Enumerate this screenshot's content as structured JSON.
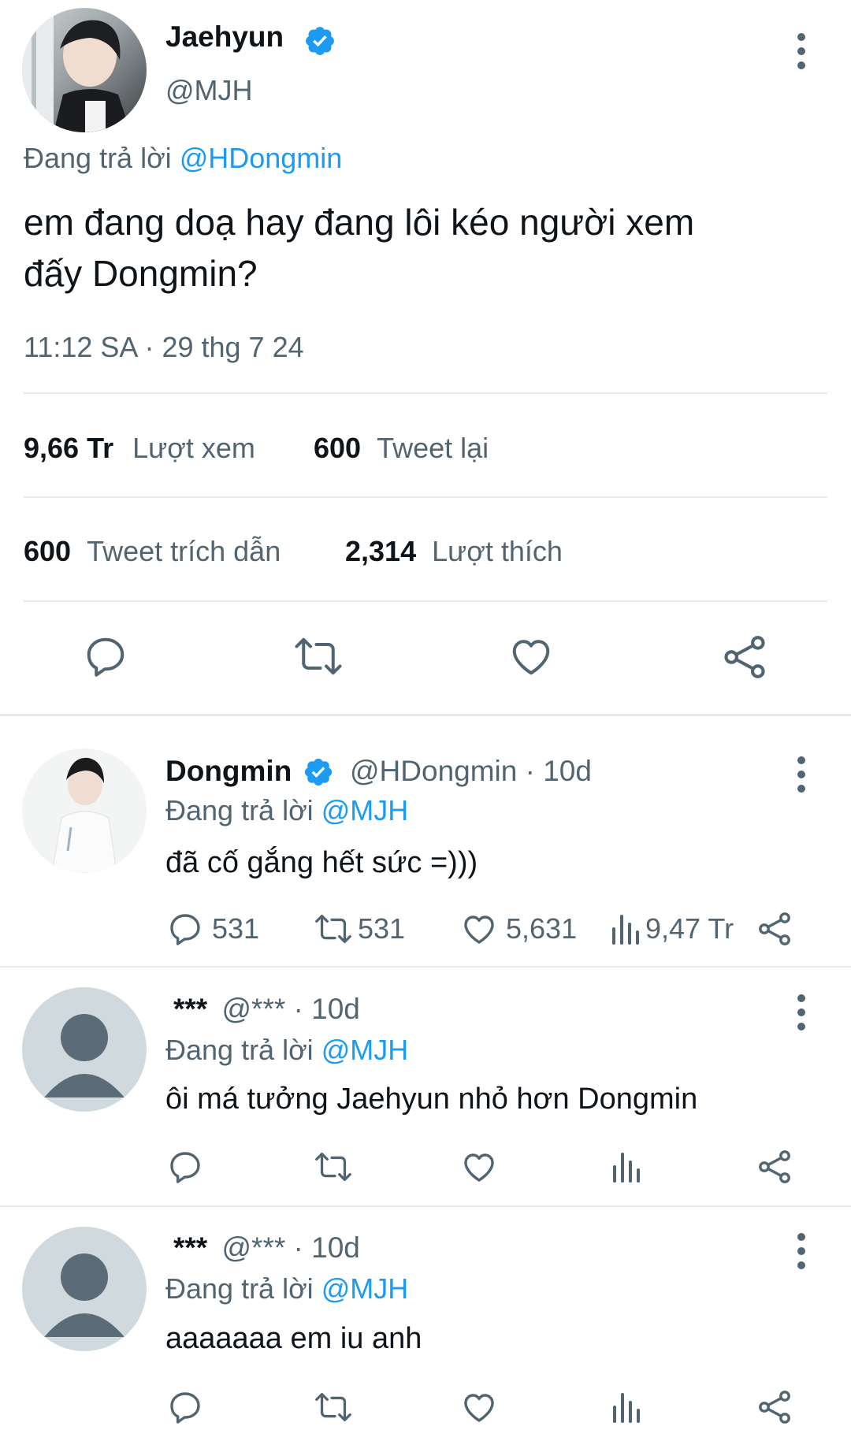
{
  "main_tweet": {
    "display_name": "Jaehyun",
    "handle": "@MJH",
    "replying_prefix": "Đang trả lời",
    "replying_to": "@HDongmin",
    "text_line1": "em đang doạ hay đang lôi kéo người xem",
    "text_line2": "đấy Dongmin?",
    "timestamp": "11:12 SA · 29 thg 7 24",
    "views_count": "9,66 Tr",
    "views_label": "Lượt xem",
    "retweets_count": "600",
    "retweets_label": "Tweet lại",
    "quotes_count": "600",
    "quotes_label": "Tweet trích dẫn",
    "likes_count": "2,314",
    "likes_label": "Lượt thích"
  },
  "replies": [
    {
      "display_name": "Dongmin",
      "meta": "@HDongmin · 10d",
      "replying_prefix": "Đang trả lời",
      "replying_to": "@MJH",
      "text": "đã cố gắng hết sức =)))",
      "reply_count": "531",
      "retweet_count": "531",
      "like_count": "5,631",
      "view_count": "9,47 Tr"
    },
    {
      "display_name": "***",
      "meta": "@*** · 10d",
      "replying_prefix": "Đang trả lời",
      "replying_to": "@MJH",
      "text": "ôi má tưởng Jaehyun nhỏ hơn Dongmin"
    },
    {
      "display_name": "***",
      "meta": "@*** · 10d",
      "replying_prefix": "Đang trả lời",
      "replying_to": "@MJH",
      "text": "aaaaaaa em iu anh"
    }
  ],
  "colors": {
    "accent": "#1d9bf0",
    "secondary_text": "#536471",
    "text": "#0f1419"
  },
  "icons": [
    "verified-icon",
    "more-icon",
    "reply-icon",
    "retweet-icon",
    "like-icon",
    "share-icon",
    "views-icon",
    "default-avatar-icon"
  ]
}
